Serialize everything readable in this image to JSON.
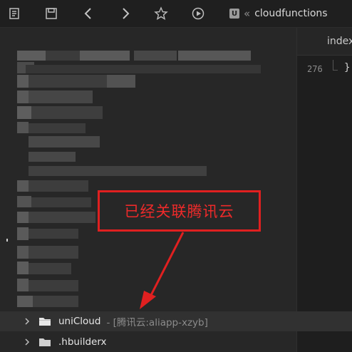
{
  "toolbar": {
    "breadcrumb_separator": "«",
    "breadcrumb_app_icon_letter": "U",
    "breadcrumb_path": "cloudfunctions"
  },
  "editor": {
    "tab_label": "index",
    "line_number": "276",
    "code_line": "}"
  },
  "annotation": {
    "text": "已经关联腾讯云",
    "color": "#e02020"
  },
  "tree": {
    "items": [
      {
        "label": "uniCloud",
        "sublabel": "- [腾讯云:aliapp-xzyb]",
        "icon": "folder-icon"
      },
      {
        "label": ".hbuilderx",
        "sublabel": "",
        "icon": "folder-icon"
      }
    ]
  },
  "colors": {
    "background": "#232323",
    "sidebar": "#272727",
    "selected_row": "#313131"
  }
}
